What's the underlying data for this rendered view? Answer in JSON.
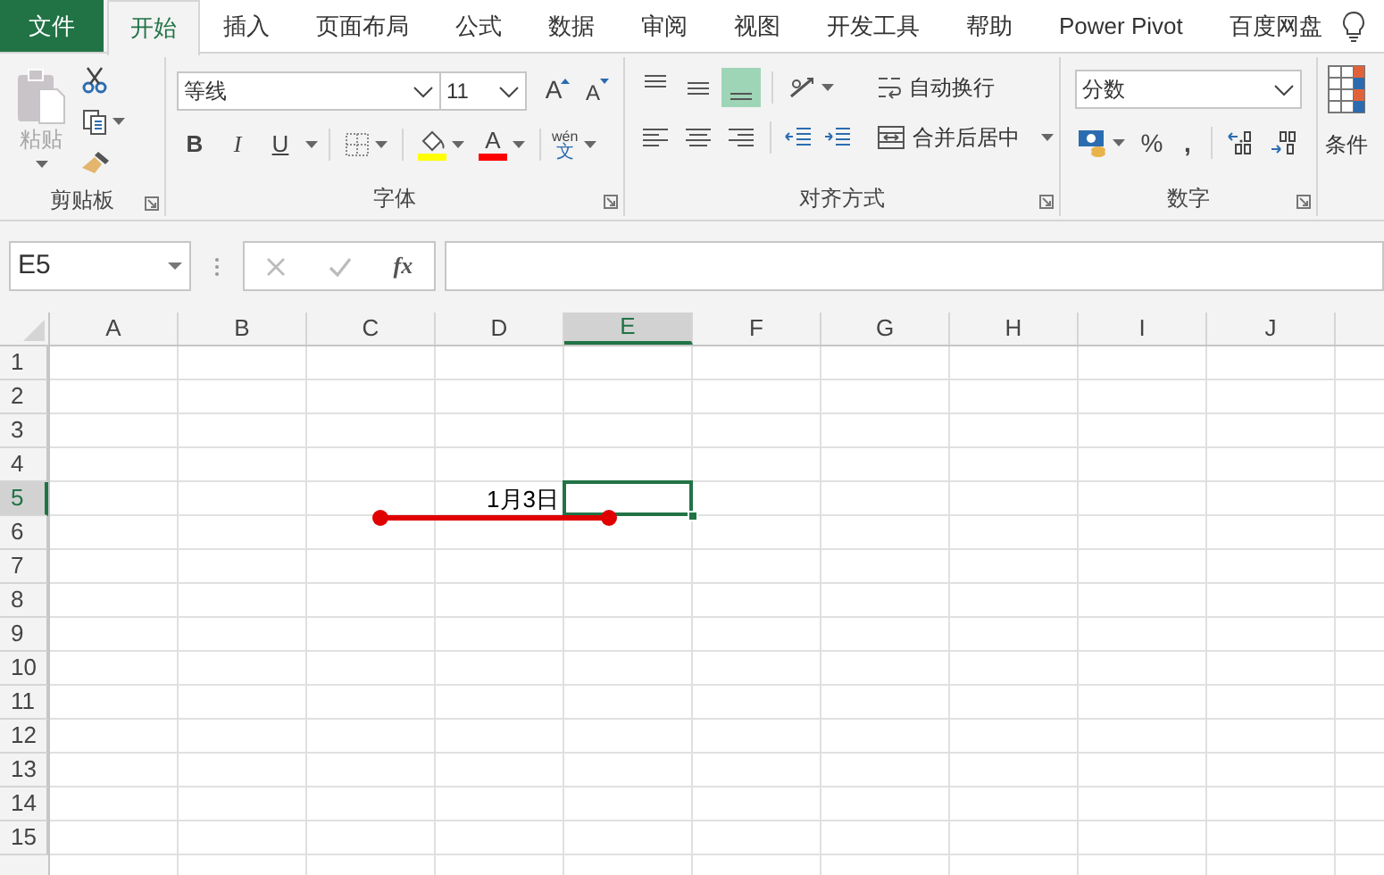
{
  "tabs": [
    {
      "label": "文件",
      "kind": "file",
      "selected": false
    },
    {
      "label": "开始",
      "kind": "tab",
      "selected": true
    },
    {
      "label": "插入",
      "kind": "tab",
      "selected": false
    },
    {
      "label": "页面布局",
      "kind": "tab",
      "selected": false
    },
    {
      "label": "公式",
      "kind": "tab",
      "selected": false
    },
    {
      "label": "数据",
      "kind": "tab",
      "selected": false
    },
    {
      "label": "审阅",
      "kind": "tab",
      "selected": false
    },
    {
      "label": "视图",
      "kind": "tab",
      "selected": false
    },
    {
      "label": "开发工具",
      "kind": "tab",
      "selected": false
    },
    {
      "label": "帮助",
      "kind": "tab",
      "selected": false
    },
    {
      "label": "Power Pivot",
      "kind": "tab",
      "selected": false
    },
    {
      "label": "百度网盘",
      "kind": "tab",
      "selected": false
    }
  ],
  "ribbon": {
    "clipboard": {
      "label": "剪贴板",
      "paste_label": "粘贴",
      "paste_disabled": true
    },
    "font": {
      "label": "字体",
      "font_name": "等线",
      "font_size": "11",
      "grow_label": "A",
      "shrink_label": "A",
      "bold_label": "B",
      "italic_label": "I",
      "underline_label": "U",
      "font_color_label": "A",
      "phonetic_top": "wén",
      "phonetic_bottom": "文"
    },
    "alignment": {
      "label": "对齐方式",
      "vertical": [
        {
          "kind": "top",
          "selected": false
        },
        {
          "kind": "middle",
          "selected": false
        },
        {
          "kind": "bottom",
          "selected": true
        }
      ],
      "horizontal": [
        {
          "kind": "left",
          "selected": false
        },
        {
          "kind": "center",
          "selected": false
        },
        {
          "kind": "right",
          "selected": false
        }
      ],
      "wrap_label": "自动换行",
      "merge_label": "合并后居中"
    },
    "number": {
      "label": "数字",
      "format": "分数",
      "percent_label": "%",
      "comma_label": ","
    },
    "styles": {
      "partial_label": "条件"
    }
  },
  "formula_bar": {
    "name_box": "E5",
    "function_label": "fx"
  },
  "grid": {
    "columns": [
      {
        "label": "A",
        "selected": false
      },
      {
        "label": "B",
        "selected": false
      },
      {
        "label": "C",
        "selected": false
      },
      {
        "label": "D",
        "selected": false
      },
      {
        "label": "E",
        "selected": true
      },
      {
        "label": "F",
        "selected": false
      },
      {
        "label": "G",
        "selected": false
      },
      {
        "label": "H",
        "selected": false
      },
      {
        "label": "I",
        "selected": false
      },
      {
        "label": "J",
        "selected": false
      }
    ],
    "rows": [
      {
        "label": "1",
        "selected": false
      },
      {
        "label": "2",
        "selected": false
      },
      {
        "label": "3",
        "selected": false
      },
      {
        "label": "4",
        "selected": false
      },
      {
        "label": "5",
        "selected": true,
        "cells": [
          null,
          null,
          null,
          "1月3日"
        ]
      },
      {
        "label": "6",
        "selected": false
      },
      {
        "label": "7",
        "selected": false
      },
      {
        "label": "8",
        "selected": false
      },
      {
        "label": "9",
        "selected": false
      },
      {
        "label": "10",
        "selected": false
      },
      {
        "label": "11",
        "selected": false
      },
      {
        "label": "12",
        "selected": false
      },
      {
        "label": "13",
        "selected": false
      },
      {
        "label": "14",
        "selected": false
      },
      {
        "label": "15",
        "selected": false
      }
    ]
  }
}
